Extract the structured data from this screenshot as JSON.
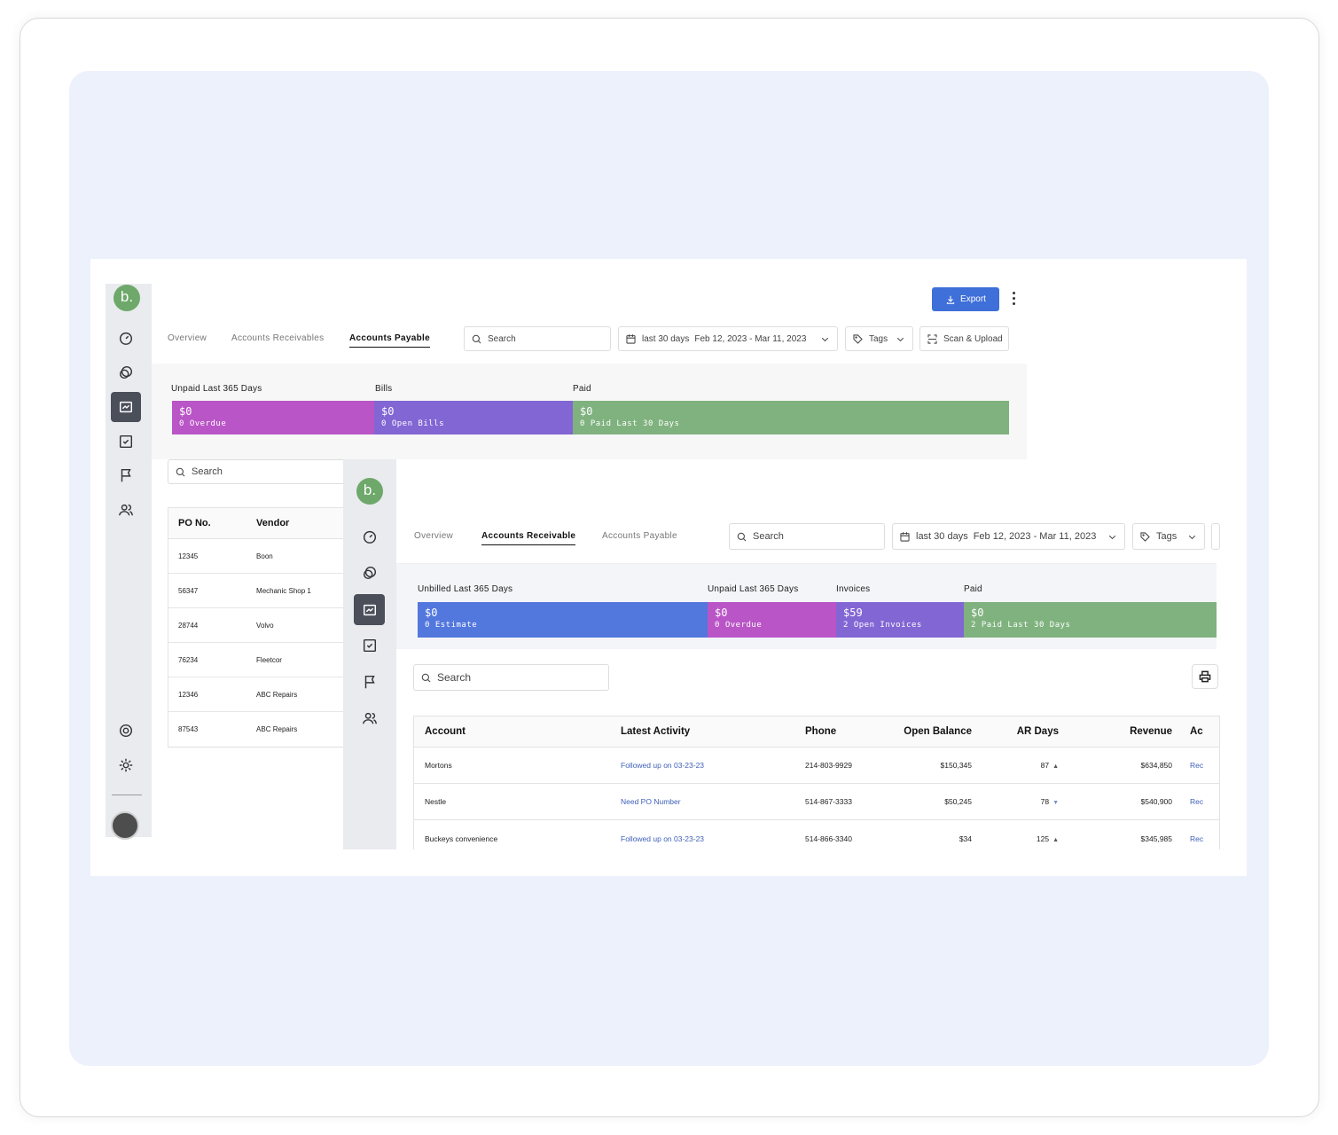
{
  "colors": {
    "background": "#edf1fc",
    "export": "#3f6fd8",
    "overdue": "#b955c6",
    "bills": "#8266d4",
    "paid": "#7fb27e",
    "estimate": "#5277dd",
    "link": "#3f5fb8",
    "logo": "#6ea86a"
  },
  "back": {
    "logo": "b.",
    "tabs": [
      "Overview",
      "Accounts Receivables",
      "Accounts Payable"
    ],
    "active_tab": "Accounts Payable",
    "search_placeholder": "Search",
    "date_range": {
      "label": "last 30 days",
      "dates": "Feb 12, 2023 - Mar 11, 2023"
    },
    "tags_label": "Tags",
    "scan_label": "Scan & Upload",
    "export_label": "Export",
    "stats": [
      {
        "label": "Unpaid Last 365 Days",
        "amount": "$0",
        "sub": "0 Overdue"
      },
      {
        "label": "Bills",
        "amount": "$0",
        "sub": "0 Open Bills"
      },
      {
        "label": "Paid",
        "amount": "$0",
        "sub": "0 Paid Last 30 Days"
      }
    ],
    "table_search_placeholder": "Search",
    "table": {
      "headers": [
        "PO No.",
        "Vendor"
      ],
      "rows": [
        [
          "12345",
          "Boon"
        ],
        [
          "56347",
          "Mechanic Shop 1"
        ],
        [
          "28744",
          "Volvo"
        ],
        [
          "76234",
          "Fleetcor"
        ],
        [
          "12346",
          "ABC Repairs"
        ],
        [
          "87543",
          "ABC Repairs"
        ]
      ]
    }
  },
  "front": {
    "logo": "b.",
    "tabs": [
      "Overview",
      "Accounts Receivable",
      "Accounts Payable"
    ],
    "active_tab": "Accounts Receivable",
    "search_placeholder": "Search",
    "date_range": {
      "label": "last 30 days",
      "dates": "Feb 12, 2023 - Mar 11, 2023"
    },
    "tags_label": "Tags",
    "stats": [
      {
        "label": "Unbilled Last 365 Days",
        "amount": "$0",
        "sub": "0 Estimate"
      },
      {
        "label": "Unpaid Last 365 Days",
        "amount": "$0",
        "sub": "0 Overdue"
      },
      {
        "label": "Invoices",
        "amount": "$59",
        "sub": "2 Open Invoices"
      },
      {
        "label": "Paid",
        "amount": "$0",
        "sub": "2 Paid Last 30 Days"
      }
    ],
    "table_search_placeholder": "Search",
    "table": {
      "headers": [
        "Account",
        "Latest Activity",
        "Phone",
        "Open Balance",
        "AR Days",
        "Revenue",
        "Ac"
      ],
      "rows": [
        {
          "account": "Mortons",
          "activity": "Followed up on 03-23-23",
          "phone": "214-803-9929",
          "balance": "$150,345",
          "ar_days": "87",
          "trend": "up",
          "revenue": "$634,850",
          "action": "Rec"
        },
        {
          "account": "Nestle",
          "activity": "Need PO Number",
          "phone": "514-867-3333",
          "balance": "$50,245",
          "ar_days": "78",
          "trend": "down",
          "revenue": "$540,900",
          "action": "Rec"
        },
        {
          "account": "Buckeys convenience",
          "activity": "Followed up on 03-23-23",
          "phone": "514-866-3340",
          "balance": "$34",
          "ar_days": "125",
          "trend": "up",
          "revenue": "$345,985",
          "action": "Rec"
        }
      ]
    }
  }
}
